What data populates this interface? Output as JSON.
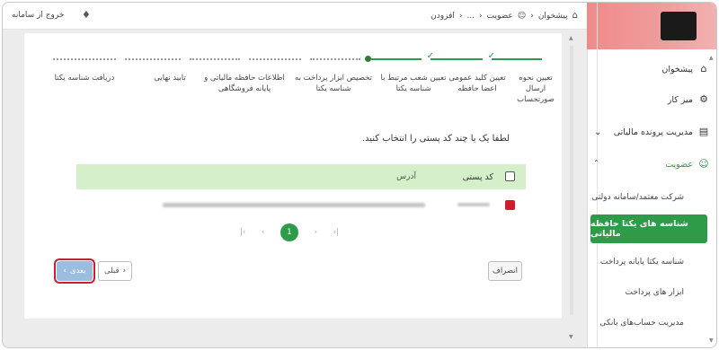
{
  "topbar": {
    "logout_label": "خروج از سامانه",
    "breadcrumbs": [
      "پیشخوان",
      "عضویت",
      "...",
      "افزودن"
    ]
  },
  "sidebar": {
    "items": [
      {
        "label": "پیشخوان",
        "icon": "home-icon"
      },
      {
        "label": "میز کار",
        "icon": "desk-icon"
      },
      {
        "label": "مدیریت پرونده مالیاتی",
        "icon": "document-icon"
      },
      {
        "label": "عضویت",
        "icon": "user-icon"
      }
    ],
    "subitems": [
      "شرکت معتمد/سامانه دولتی",
      "شناسه های یکتا حافظه مالیاتی",
      "شناسه یکتا پایانه پرداخت",
      "ابزار های پرداخت",
      "مدیریت حساب‌های بانکی"
    ],
    "active_subitem_index": 1
  },
  "stepper": {
    "steps": [
      "تعیین نحوه ارسال صورتحساب",
      "تعیین کلید عمومی اعضا حافظه",
      "تعیین شعب مرتبط با شناسه یکتا",
      "تخصیص ابزار پرداخت به شناسه یکتا",
      "اطلاعات حافظه مالیاتی و پایانه فروشگاهی",
      "تایید نهایی",
      "دریافت شناسه یکتا"
    ],
    "completed": 2,
    "current": 3
  },
  "instruction": "لطفا یک یا چند کد پستی را انتخاب کنید.",
  "table": {
    "headers": {
      "postal_code": "کد پستی",
      "address": "آدرس"
    }
  },
  "pagination": {
    "current_page": "1"
  },
  "buttons": {
    "next": "بعدی",
    "prev": "قبلی",
    "cancel": "انصراف"
  },
  "colors": {
    "accent": "#2e9b48",
    "header_bg": "#d6efcb",
    "highlight": "#c91f2e"
  }
}
